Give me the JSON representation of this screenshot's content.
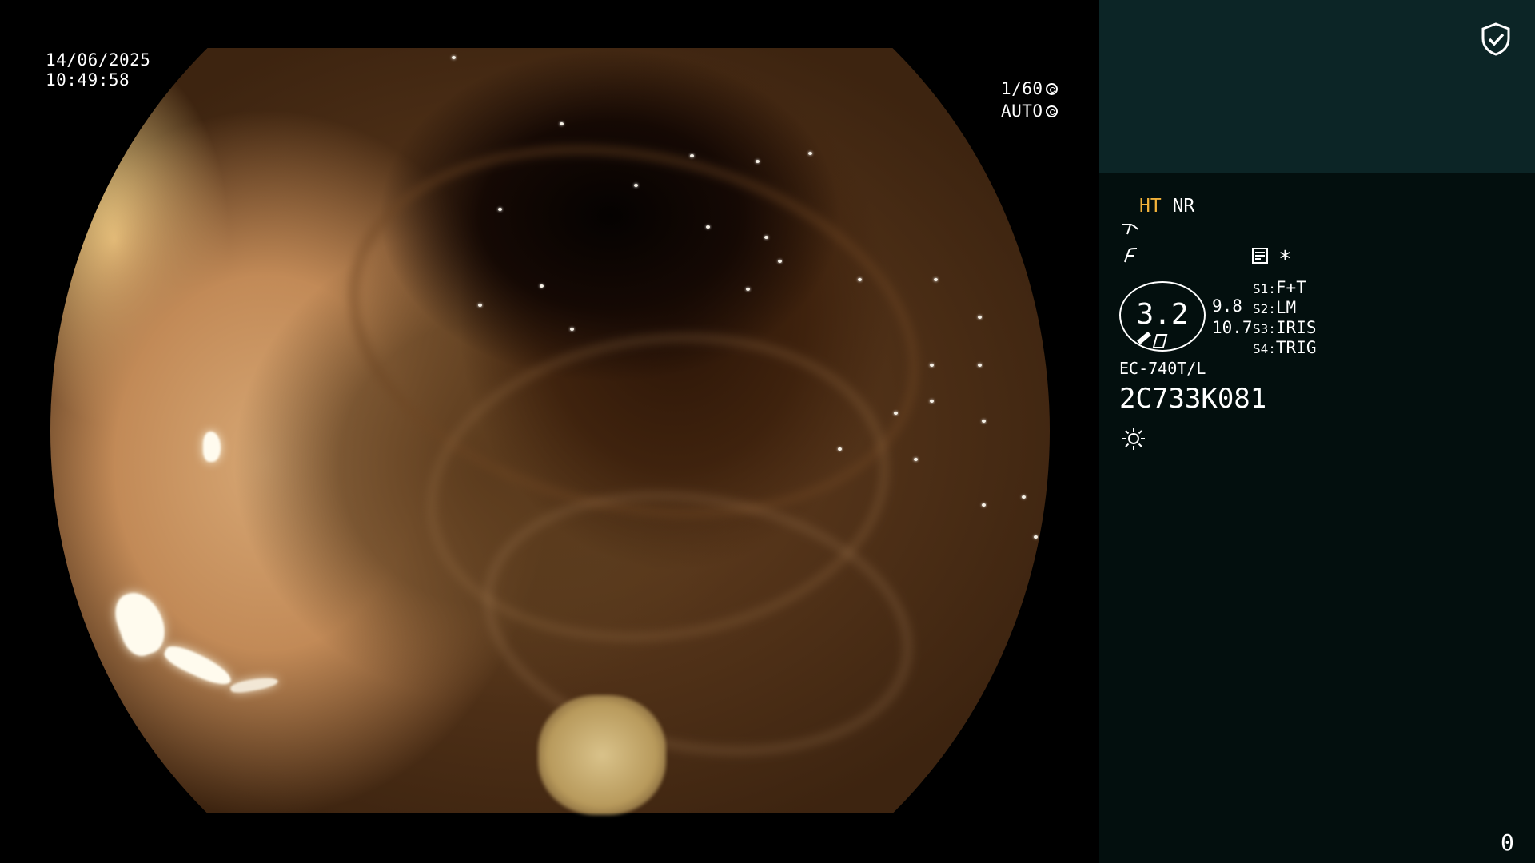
{
  "overlay": {
    "date": "14/06/2025",
    "time": "10:49:58",
    "shutter": "1/60",
    "iris_mode": "AUTO"
  },
  "panel": {
    "image_mode_ht": "HT",
    "image_mode_nr": "NR",
    "enhance_symbol": "∗",
    "zoom": "3.2",
    "zoom_values": [
      "9.8",
      "10.7"
    ],
    "switches": [
      {
        "key": "S1:",
        "value": "F+T"
      },
      {
        "key": "S2:",
        "value": "LM"
      },
      {
        "key": "S3:",
        "value": "IRIS"
      },
      {
        "key": "S4:",
        "value": "TRIG"
      }
    ],
    "scope_model": "EC-740T/L",
    "serial": "2C733K081",
    "counter": "0"
  },
  "icons": {
    "shield": "shield-check-icon",
    "brightness": "sun-icon",
    "structure": "structure-enhance-icon",
    "color": "color-enhance-icon",
    "memo": "memo-icon"
  },
  "colors": {
    "panel_bg": "#030f0e",
    "panel_top_bg": "#0c2526",
    "ht_accent": "#f2b23a"
  }
}
